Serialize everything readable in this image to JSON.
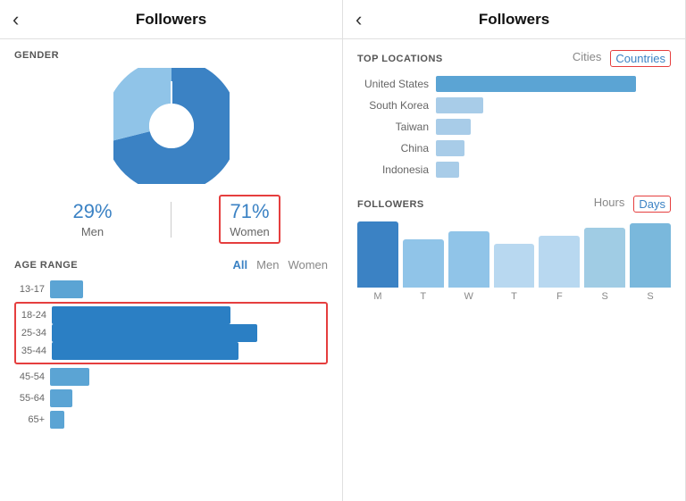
{
  "leftPanel": {
    "header": {
      "back_label": "<",
      "title": "Followers"
    },
    "gender": {
      "section_label": "GENDER",
      "pie": {
        "men_pct": 29,
        "women_pct": 71,
        "men_color": "#90c4e8",
        "women_color": "#3b82c4"
      },
      "men_percent": "29%",
      "men_label": "Men",
      "women_percent": "71%",
      "women_label": "Women"
    },
    "age_range": {
      "section_label": "AGE RANGE",
      "tabs": [
        "All",
        "Men",
        "Women"
      ],
      "active_tab": "All",
      "bars": [
        {
          "label": "13-17",
          "width": 12,
          "highlighted": false
        },
        {
          "label": "18-24",
          "width": 65,
          "highlighted": true
        },
        {
          "label": "25-34",
          "width": 75,
          "highlighted": true
        },
        {
          "label": "35-44",
          "width": 68,
          "highlighted": true
        },
        {
          "label": "45-54",
          "width": 14,
          "highlighted": false
        },
        {
          "label": "55-64",
          "width": 8,
          "highlighted": false
        },
        {
          "label": "65+",
          "width": 5,
          "highlighted": false
        }
      ]
    }
  },
  "rightPanel": {
    "header": {
      "back_label": "<",
      "title": "Followers"
    },
    "top_locations": {
      "section_label": "TOP LOCATIONS",
      "tabs": [
        "Cities",
        "Countries"
      ],
      "active_tab": "Countries",
      "rows": [
        {
          "name": "United States",
          "width": 85
        },
        {
          "name": "South Korea",
          "width": 20
        },
        {
          "name": "Taiwan",
          "width": 15
        },
        {
          "name": "China",
          "width": 12
        },
        {
          "name": "Indonesia",
          "width": 10
        }
      ]
    },
    "followers_chart": {
      "section_label": "FOLLOWERS",
      "tabs": [
        "Hours",
        "Days"
      ],
      "active_tab": "Days",
      "bars": [
        {
          "label": "M",
          "height": 90,
          "color": "#3b82c4"
        },
        {
          "label": "T",
          "height": 60,
          "color": "#90c4e8"
        },
        {
          "label": "W",
          "height": 70,
          "color": "#90c4e8"
        },
        {
          "label": "T",
          "height": 55,
          "color": "#b8d8f0"
        },
        {
          "label": "F",
          "height": 65,
          "color": "#b8d8f0"
        },
        {
          "label": "S",
          "height": 75,
          "color": "#a0cce4"
        },
        {
          "label": "S",
          "height": 80,
          "color": "#7ab8dc"
        }
      ]
    }
  }
}
